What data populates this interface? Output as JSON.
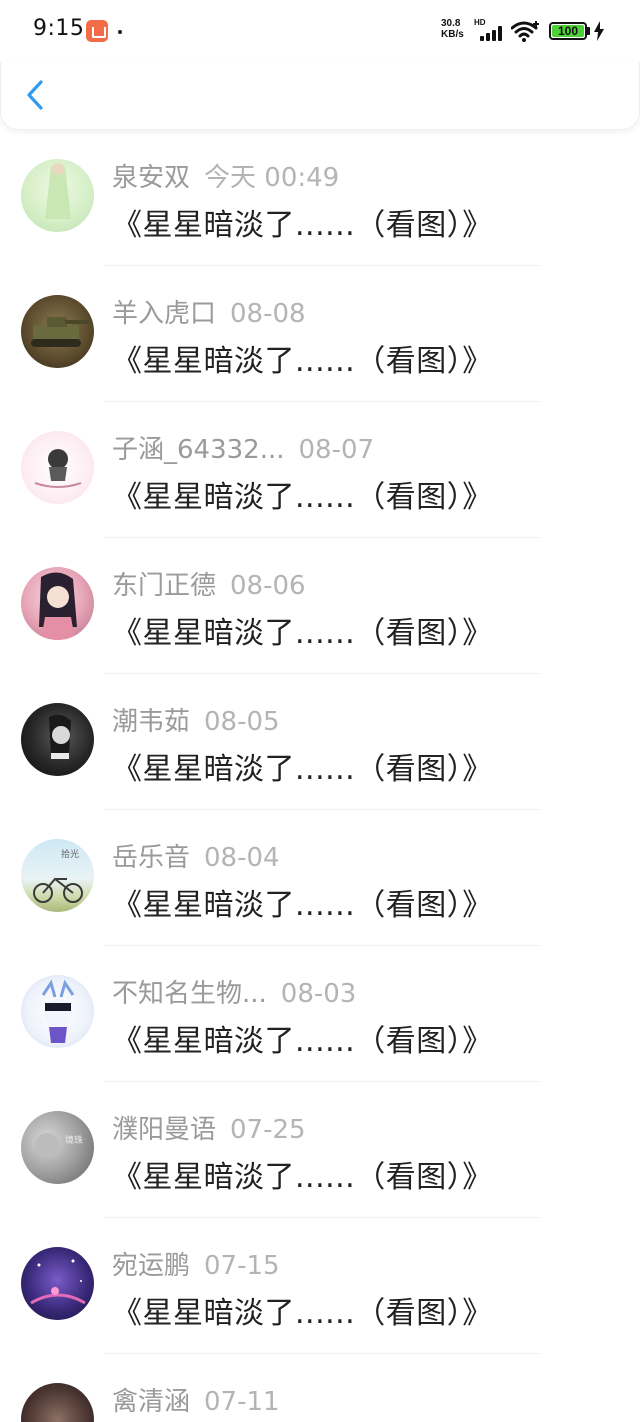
{
  "status_bar": {
    "time": "9:15",
    "net_speed_value": "30.8",
    "net_speed_unit": "KB/s",
    "hd_label": "HD",
    "battery": "100",
    "battery_color": "#4cd137"
  },
  "header": {
    "back_icon": "chevron-left-icon",
    "accent_color": "#2f9cf0"
  },
  "items": [
    {
      "name": "泉安双",
      "date": "今天 00:49",
      "title": "《星星暗淡了......（看图）》"
    },
    {
      "name": "羊入虎口",
      "date": "08-08",
      "title": "《星星暗淡了......（看图）》"
    },
    {
      "name": "子涵_64332...",
      "date": "08-07",
      "title": "《星星暗淡了......（看图）》"
    },
    {
      "name": "东门正德",
      "date": "08-06",
      "title": "《星星暗淡了......（看图）》"
    },
    {
      "name": "潮韦茹",
      "date": "08-05",
      "title": "《星星暗淡了......（看图）》"
    },
    {
      "name": "岳乐音",
      "date": "08-04",
      "title": "《星星暗淡了......（看图）》"
    },
    {
      "name": "不知名生物...",
      "date": "08-03",
      "title": "《星星暗淡了......（看图）》"
    },
    {
      "name": "濮阳曼语",
      "date": "07-25",
      "title": "《星星暗淡了......（看图）》"
    },
    {
      "name": "宛运鹏",
      "date": "07-15",
      "title": "《星星暗淡了......（看图）》"
    },
    {
      "name": "禽清涵",
      "date": "07-11",
      "title": ""
    }
  ]
}
